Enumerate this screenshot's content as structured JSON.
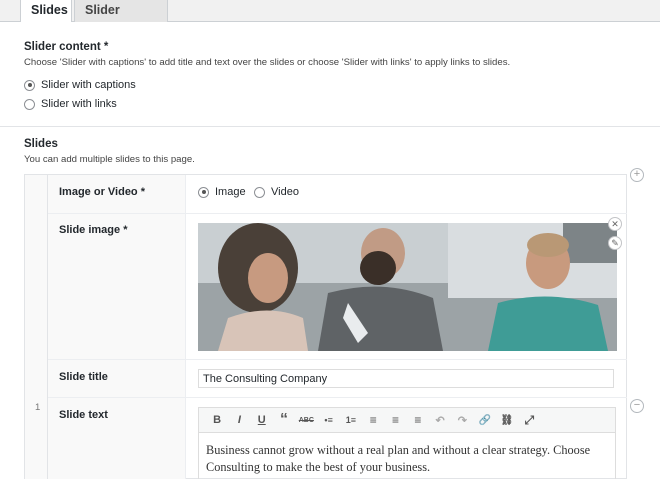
{
  "tabs": [
    "Slides",
    "Slider settings"
  ],
  "slider_content": {
    "label": "Slider content *",
    "description": "Choose 'Slider with captions' to add title and text over the slides or choose 'Slider with links' to apply links to slides.",
    "options": [
      "Slider with captions",
      "Slider with links"
    ],
    "selected": "Slider with captions"
  },
  "slides": {
    "label": "Slides",
    "description": "You can add multiple slides to this page.",
    "row_number": "1",
    "fields": {
      "media_type_label": "Image or Video  *",
      "media_options": [
        "Image",
        "Video"
      ],
      "media_selected": "Image",
      "slide_image_label": "Slide image  *",
      "slide_title_label": "Slide title",
      "slide_title_value": "The Consulting Company",
      "slide_text_label": "Slide text",
      "slide_text_value": "Business cannot grow without a real plan and without a clear strategy. Choose Consulting to make the best of your business."
    }
  },
  "toolbar_buttons": [
    "B",
    "I",
    "U",
    "“",
    "ABC",
    "•≡",
    "1≡",
    "≡",
    "≡",
    "≡",
    "↶",
    "↷",
    "🔗",
    "⛓",
    "⤢"
  ],
  "icons": [
    "add-row-icon",
    "remove-row-icon",
    "remove-image-icon",
    "edit-image-icon"
  ]
}
